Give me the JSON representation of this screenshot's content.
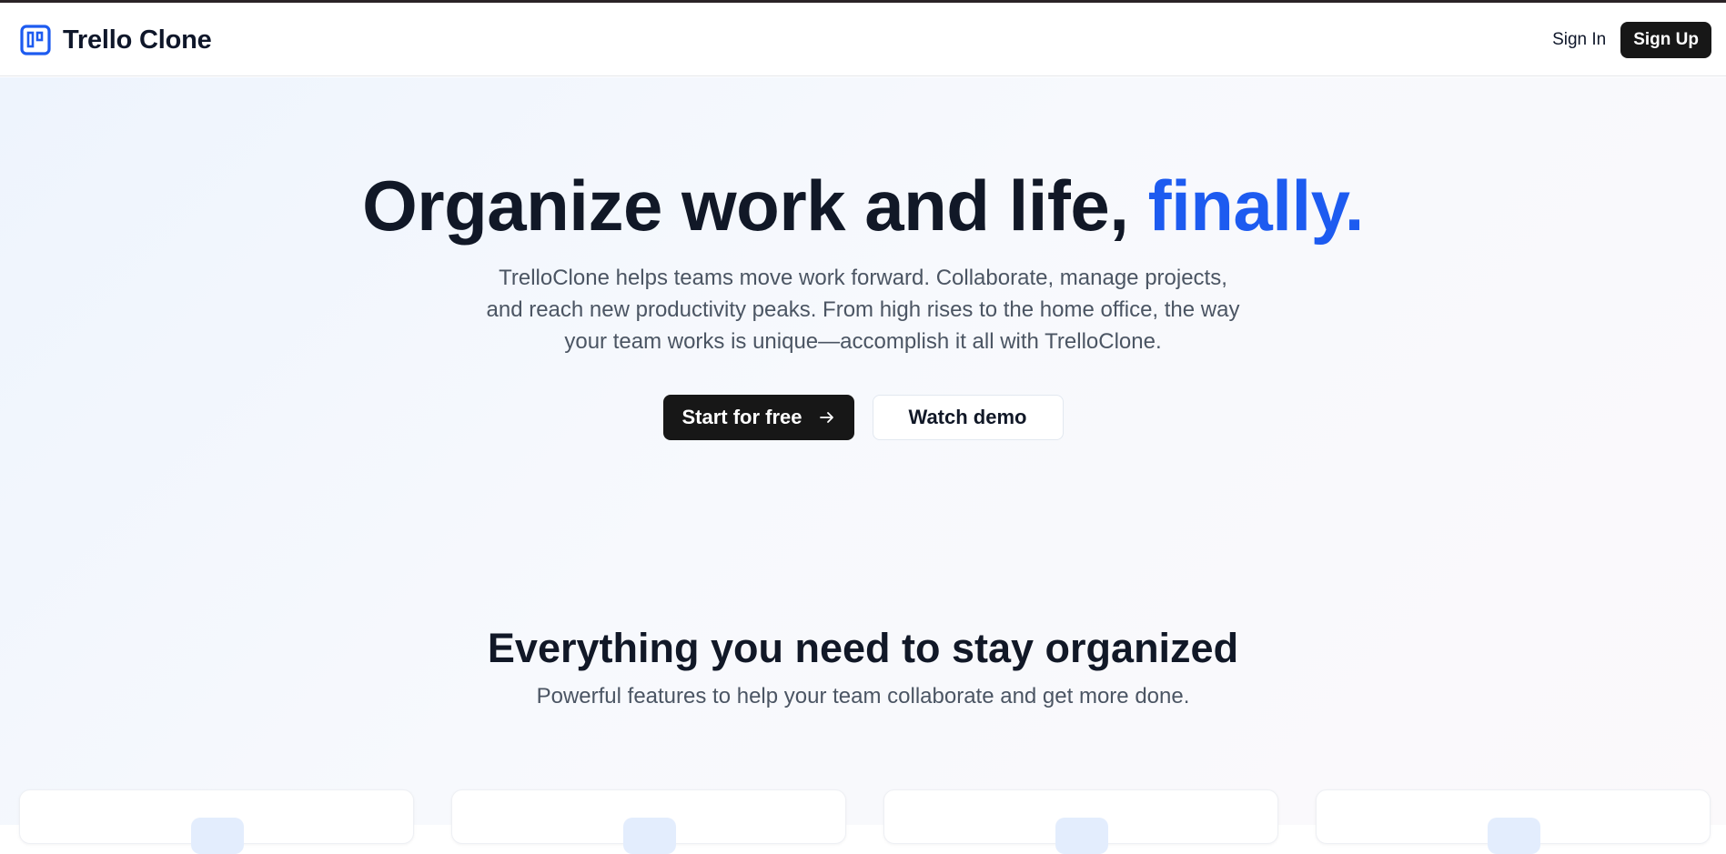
{
  "header": {
    "brand_name": "Trello Clone",
    "brand_icon": "kanban-board-icon",
    "sign_in_label": "Sign In",
    "sign_up_label": "Sign Up"
  },
  "hero": {
    "title_main": "Organize work and life, ",
    "title_accent": "finally.",
    "subtitle": "TrelloClone helps teams move work forward. Collaborate, manage projects, and reach new productivity peaks. From high rises to the home office, the way your team works is unique—accomplish it all with TrelloClone.",
    "primary_cta": "Start for free",
    "primary_cta_icon": "arrow-right-icon",
    "secondary_cta": "Watch demo"
  },
  "features": {
    "title": "Everything you need to stay organized",
    "subtitle": "Powerful features to help your team collaborate and get more done."
  },
  "colors": {
    "accent": "#1d5bf0",
    "dark_button": "#171717",
    "heading": "#111827",
    "body_text": "#4b5563",
    "feature_icon_bg": "#e3edfd"
  }
}
